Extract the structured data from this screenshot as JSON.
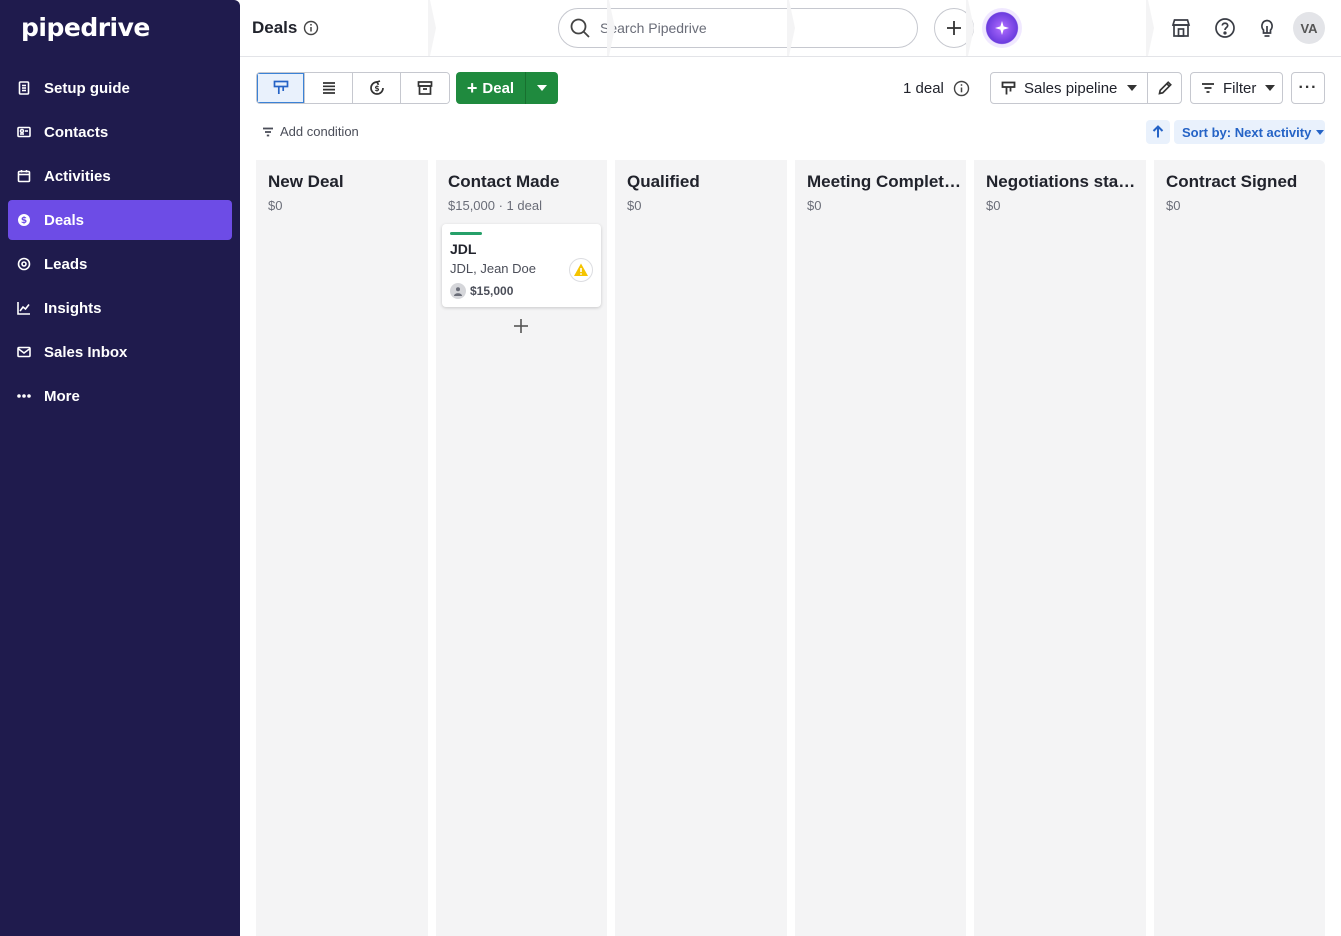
{
  "app": {
    "logo": "pipedrive"
  },
  "sidebar": {
    "items": [
      {
        "label": "Setup guide",
        "icon": "setup-guide-icon"
      },
      {
        "label": "Contacts",
        "icon": "contacts-icon"
      },
      {
        "label": "Activities",
        "icon": "activities-icon"
      },
      {
        "label": "Deals",
        "icon": "deals-icon",
        "active": true
      },
      {
        "label": "Leads",
        "icon": "leads-icon"
      },
      {
        "label": "Insights",
        "icon": "insights-icon"
      },
      {
        "label": "Sales Inbox",
        "icon": "mail-icon"
      },
      {
        "label": "More",
        "icon": "more-dots-icon"
      }
    ]
  },
  "header": {
    "title": "Deals",
    "search_placeholder": "Search Pipedrive",
    "avatar_initials": "VA"
  },
  "toolbar": {
    "deal_button_label": "Deal",
    "deal_count": "1 deal",
    "pipeline_label": "Sales pipeline",
    "filter_label": "Filter",
    "add_condition_label": "Add condition",
    "sort_label": "Sort by: Next activity"
  },
  "board": {
    "stages": [
      {
        "title": "New Deal",
        "summary": "$0"
      },
      {
        "title": "Contact Made",
        "summary": "$15,000 · 1 deal"
      },
      {
        "title": "Qualified",
        "summary": "$0"
      },
      {
        "title": "Meeting Completed",
        "summary": "$0"
      },
      {
        "title": "Negotiations start...",
        "summary": "$0"
      },
      {
        "title": "Contract Signed",
        "summary": "$0"
      }
    ],
    "card": {
      "title": "JDL",
      "subtitle": "JDL, Jean Doe",
      "value": "$15,000"
    }
  },
  "colors": {
    "sidebar_bg": "#1f1b4d",
    "sidebar_active": "#6d4ce6",
    "primary_green": "#1f8a3e",
    "accent_blue": "#2563c6",
    "card_bar": "#26a069",
    "warning": "#f5c400"
  }
}
